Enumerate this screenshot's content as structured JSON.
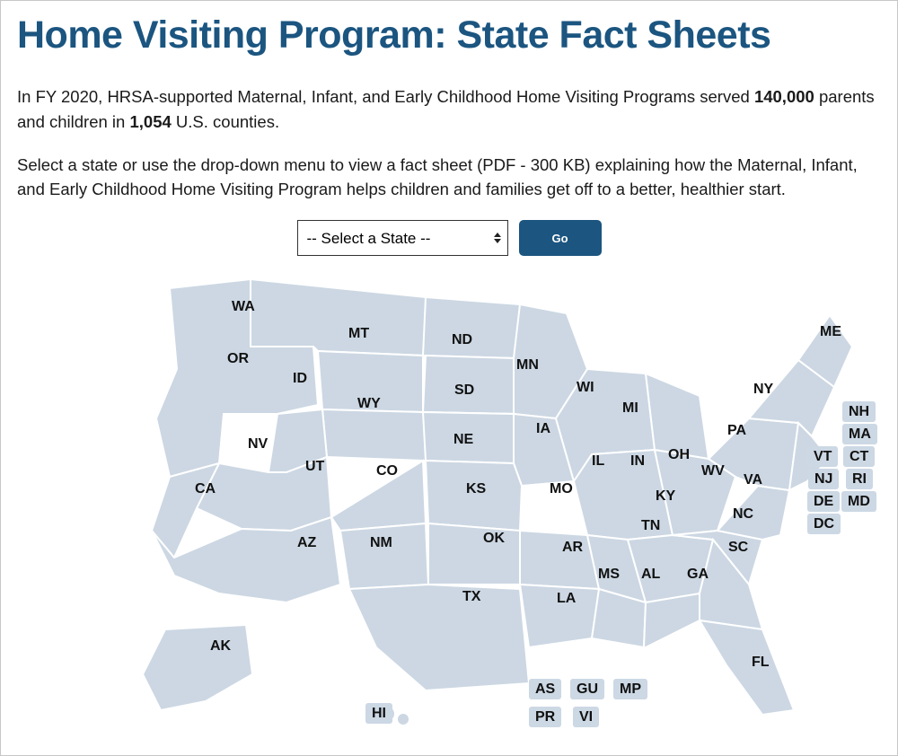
{
  "title": "Home Visiting Program: State Fact Sheets",
  "intro": {
    "prefix": "In FY 2020, HRSA-supported Maternal, Infant, and Early Childhood Home Visiting Programs served ",
    "served": "140,000",
    "middle": " parents and children in ",
    "counties": "1,054",
    "suffix": " U.S. counties."
  },
  "instructions": "Select a state or use the drop-down menu to view a fact sheet (PDF - 300 KB) explaining how the Maternal, Infant, and Early Childhood Home Visiting Program helps children and families get off to a better, healthier start.",
  "controls": {
    "select_placeholder": "-- Select a State --",
    "go_label": "Go"
  },
  "states_on_map": {
    "WA": "WA",
    "OR": "OR",
    "CA": "CA",
    "NV": "NV",
    "ID": "ID",
    "MT": "MT",
    "WY": "WY",
    "UT": "UT",
    "AZ": "AZ",
    "CO": "CO",
    "NM": "NM",
    "ND": "ND",
    "SD": "SD",
    "NE": "NE",
    "KS": "KS",
    "OK": "OK",
    "TX": "TX",
    "MN": "MN",
    "IA": "IA",
    "MO": "MO",
    "AR": "AR",
    "LA": "LA",
    "WI": "WI",
    "IL": "IL",
    "MS": "MS",
    "MI": "MI",
    "IN": "IN",
    "OH": "OH",
    "KY": "KY",
    "TN": "TN",
    "AL": "AL",
    "GA": "GA",
    "FL": "FL",
    "SC": "SC",
    "NC": "NC",
    "WV": "WV",
    "VA": "VA",
    "PA": "PA",
    "NY": "NY",
    "ME": "ME",
    "AK": "AK",
    "HI": "HI"
  },
  "chips_east": {
    "NH": "NH",
    "MA": "MA",
    "VT": "VT",
    "CT": "CT",
    "NJ": "NJ",
    "RI": "RI",
    "DE": "DE",
    "MD": "MD",
    "DC": "DC"
  },
  "territories": {
    "AS": "AS",
    "GU": "GU",
    "MP": "MP",
    "PR": "PR",
    "VI": "VI"
  },
  "colors": {
    "map_fill": "#ccd7e3",
    "map_stroke": "#ffffff",
    "accent": "#1b5580"
  }
}
